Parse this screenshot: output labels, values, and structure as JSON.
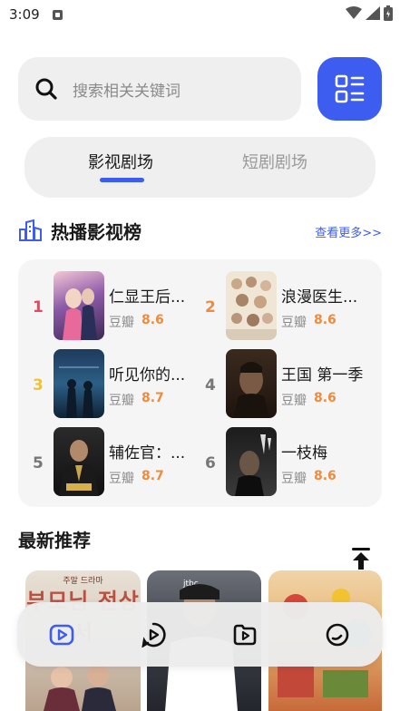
{
  "status_bar": {
    "time": "3:09"
  },
  "search": {
    "placeholder": "搜索相关关键词"
  },
  "tabs": [
    {
      "label": "影视剧场",
      "active": true
    },
    {
      "label": "短剧剧场",
      "active": false
    }
  ],
  "hot_section": {
    "title": "热播影视榜",
    "more": "查看更多>>"
  },
  "rankings": [
    {
      "rank": "1",
      "title": "仁显王后...",
      "score_label": "豆瓣",
      "score": "8.6",
      "rank_color": "#e8475f"
    },
    {
      "rank": "2",
      "title": "浪漫医生...",
      "score_label": "豆瓣",
      "score": "8.6",
      "rank_color": "#f08a3c"
    },
    {
      "rank": "3",
      "title": "听见你的...",
      "score_label": "豆瓣",
      "score": "8.7",
      "rank_color": "#f2c230"
    },
    {
      "rank": "4",
      "title": "王国 第一季",
      "score_label": "豆瓣",
      "score": "8.6",
      "rank_color": "#777777"
    },
    {
      "rank": "5",
      "title": "辅佐官：...",
      "score_label": "豆瓣",
      "score": "8.7",
      "rank_color": "#777777"
    },
    {
      "rank": "6",
      "title": "一枝梅",
      "score_label": "豆瓣",
      "score": "8.6",
      "rank_color": "#777777"
    }
  ],
  "new_section": {
    "title": "最新推荐"
  },
  "thumbnails": [
    {
      "top_text": "주말 드라마",
      "title": "부모님 전상서"
    },
    {
      "top_text": "jtbc"
    },
    {
      "top_text": ""
    }
  ],
  "colors": {
    "accent": "#3d5cf0",
    "score": "#f08a3c"
  },
  "bottom_nav": [
    {
      "icon": "video-icon",
      "active": true
    },
    {
      "icon": "play-circle-icon",
      "active": false
    },
    {
      "icon": "folder-play-icon",
      "active": false
    },
    {
      "icon": "profile-icon",
      "active": false
    }
  ]
}
